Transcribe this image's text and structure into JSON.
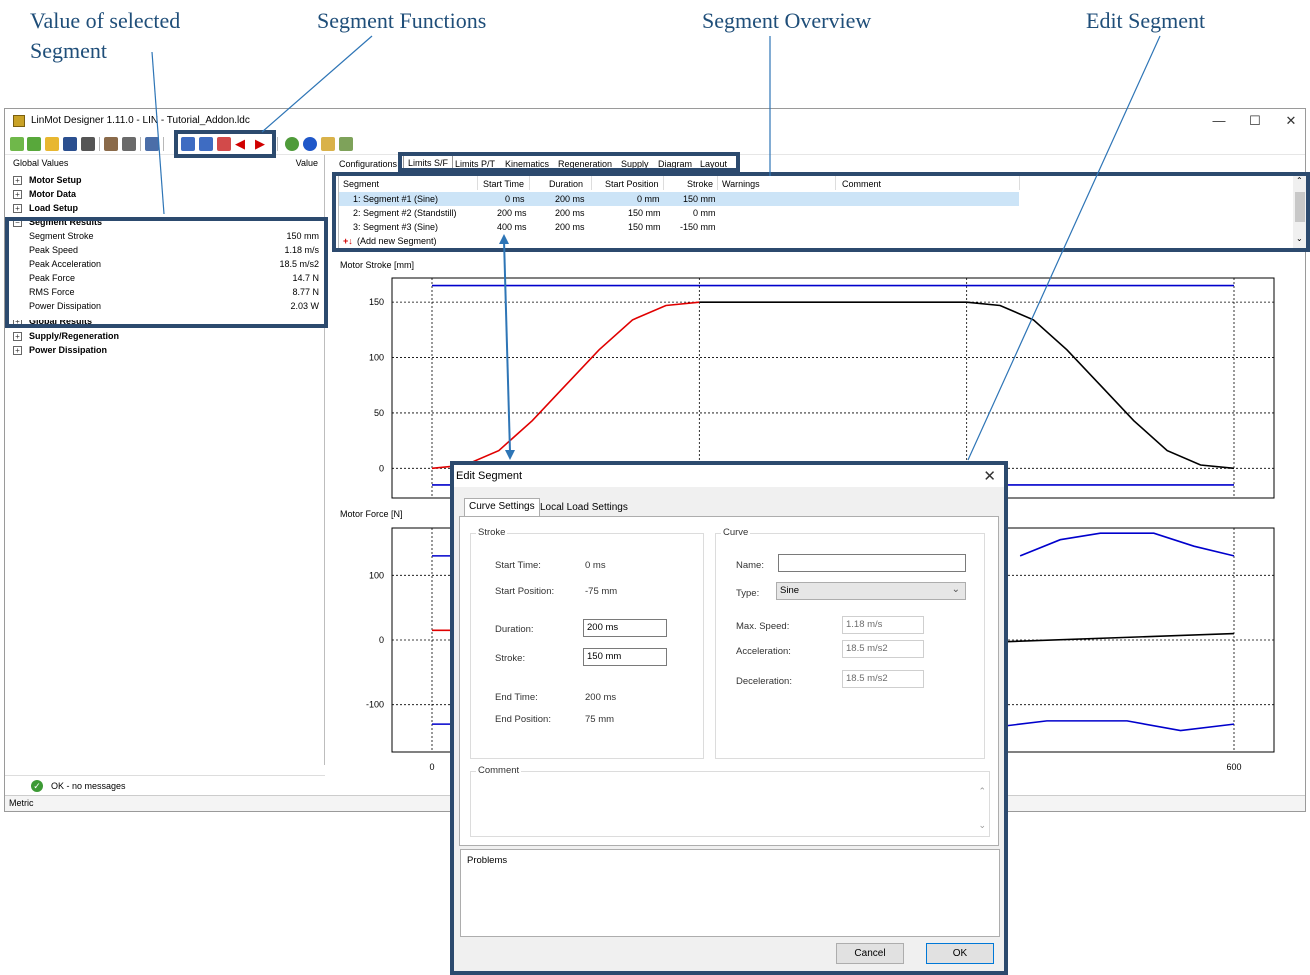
{
  "annotations": {
    "value_of_selected_segment": "Value of selected Segment",
    "value_line1": "Value of selected",
    "value_line2": "Segment",
    "segment_functions": "Segment Functions",
    "segment_overview": "Segment Overview",
    "edit_segment": "Edit Segment",
    "highlight_color": "#2c4a6e"
  },
  "window": {
    "title": "LinMot Designer 1.11.0 - LIN - Tutorial_Addon.ldc",
    "minimize": "—",
    "maximize": "☐",
    "close": "✕"
  },
  "left_panel": {
    "header_col1": "Global Values",
    "header_col2": "Value",
    "groups_top": [
      {
        "label": "Motor Setup",
        "state": "+"
      },
      {
        "label": "Motor Data",
        "state": "+"
      },
      {
        "label": "Load Setup",
        "state": "+"
      }
    ],
    "segment_results": {
      "label": "Segment Results",
      "state": "−",
      "rows": [
        {
          "label": "Segment Stroke",
          "value": "150 mm"
        },
        {
          "label": "Peak Speed",
          "value": "1.18 m/s"
        },
        {
          "label": "Peak Acceleration",
          "value": "18.5 m/s2"
        },
        {
          "label": "Peak Force",
          "value": "14.7 N"
        },
        {
          "label": "RMS Force",
          "value": "8.77 N"
        },
        {
          "label": "Power Dissipation",
          "value": "2.03 W"
        }
      ]
    },
    "groups_bottom": [
      {
        "label": "Global Results",
        "state": "+"
      },
      {
        "label": "Supply/Regeneration",
        "state": "+"
      },
      {
        "label": "Power Dissipation",
        "state": "+"
      }
    ],
    "status_message": "OK - no messages",
    "unit_system": "Metric"
  },
  "tabs": [
    "Configurations",
    "Limits S/F",
    "Limits P/T",
    "Kinematics",
    "Regeneration",
    "Supply",
    "Diagram",
    "Layout"
  ],
  "active_tab": "Limits S/F",
  "segment_table": {
    "columns": [
      "Segment",
      "Start Time",
      "Duration",
      "Start Position",
      "Stroke",
      "Warnings",
      "Comment"
    ],
    "rows": [
      {
        "segment": "1:  Segment #1 (Sine)",
        "start_time": "0 ms",
        "duration": "200 ms",
        "start_position": "0 mm",
        "stroke": "150 mm",
        "selected": true
      },
      {
        "segment": "2:  Segment #2 (Standstill)",
        "start_time": "200 ms",
        "duration": "200 ms",
        "start_position": "150 mm",
        "stroke": "0 mm",
        "selected": false
      },
      {
        "segment": "3:  Segment #3 (Sine)",
        "start_time": "400 ms",
        "duration": "200 ms",
        "start_position": "150 mm",
        "stroke": "-150 mm",
        "selected": false
      }
    ],
    "add_new": "(Add new Segment)"
  },
  "charts": {
    "stroke_title": "Motor Stroke [mm]",
    "stroke_ticks": [
      "150",
      "100",
      "50",
      "0"
    ],
    "force_title": "Motor Force [N]",
    "force_ticks": [
      "100",
      "0",
      "-100"
    ],
    "x_ticks": [
      "0",
      "600"
    ],
    "colors": {
      "selected": "#e00000",
      "other": "#000000",
      "limit": "#0000cc"
    }
  },
  "chart_data": [
    {
      "type": "line",
      "title": "Motor Stroke [mm]",
      "xlim": [
        0,
        600
      ],
      "ylim": [
        -25,
        170
      ],
      "series": [
        {
          "color": "#e00000",
          "x": [
            0,
            25,
            50,
            75,
            100,
            125,
            150,
            175,
            200
          ],
          "y": [
            0,
            3,
            16,
            43,
            75,
            107,
            134,
            147,
            150
          ]
        },
        {
          "color": "#000000",
          "x": [
            200,
            400,
            425,
            450,
            475,
            500,
            525,
            550,
            575,
            600
          ],
          "y": [
            150,
            150,
            147,
            134,
            107,
            75,
            43,
            16,
            3,
            0
          ]
        },
        {
          "color": "#0000cc",
          "x": [
            0,
            600
          ],
          "y": [
            165,
            165
          ]
        },
        {
          "color": "#0000cc",
          "x": [
            0,
            600
          ],
          "y": [
            -15,
            -15
          ]
        }
      ]
    },
    {
      "type": "line",
      "title": "Motor Force [N]",
      "xlim": [
        0,
        600
      ],
      "ylim": [
        -170,
        170
      ],
      "series": [
        {
          "color": "#e00000",
          "x": [
            0,
            20
          ],
          "y": [
            15,
            15
          ]
        },
        {
          "color": "#000000",
          "x": [
            330,
            600
          ],
          "y": [
            -10,
            10
          ]
        },
        {
          "color": "#0000cc",
          "x": [
            0,
            20
          ],
          "y": [
            130,
            130
          ]
        },
        {
          "color": "#0000cc",
          "x": [
            440,
            470,
            500,
            540,
            570,
            600
          ],
          "y": [
            130,
            155,
            165,
            165,
            145,
            130
          ]
        },
        {
          "color": "#0000cc",
          "x": [
            0,
            20
          ],
          "y": [
            -130,
            -130
          ]
        },
        {
          "color": "#0000cc",
          "x": [
            330,
            400,
            460,
            520,
            560,
            600
          ],
          "y": [
            -140,
            -140,
            -125,
            -125,
            -140,
            -130
          ]
        }
      ]
    }
  ],
  "dialog": {
    "title": "Edit Segment",
    "close": "✕",
    "tabs": [
      "Curve Settings",
      "Local Load Settings"
    ],
    "stroke_group": "Stroke",
    "curve_group": "Curve",
    "start_time_label": "Start Time:",
    "start_time_value": "0 ms",
    "start_position_label": "Start Position:",
    "start_position_value": "-75 mm",
    "duration_label": "Duration:",
    "duration_value": "200 ms",
    "stroke_label": "Stroke:",
    "stroke_value": "150 mm",
    "end_time_label": "End Time:",
    "end_time_value": "200 ms",
    "end_position_label": "End Position:",
    "end_position_value": "75 mm",
    "name_label": "Name:",
    "name_value": "",
    "type_label": "Type:",
    "type_value": "Sine",
    "max_speed_label": "Max. Speed:",
    "max_speed_value": "1.18 m/s",
    "acceleration_label": "Acceleration:",
    "acceleration_value": "18.5 m/s2",
    "deceleration_label": "Deceleration:",
    "deceleration_value": "18.5 m/s2",
    "comment_label": "Comment",
    "problems_label": "Problems",
    "cancel": "Cancel",
    "ok": "OK"
  },
  "toolbar_icons": [
    "new-file-icon",
    "refresh-icon",
    "open-folder-icon",
    "save-icon",
    "print-icon",
    "motor-icon",
    "motor-select-icon",
    "segment-list-icon",
    "add-segment-icon",
    "insert-segment-icon",
    "segment-chart-icon",
    "move-left-icon",
    "move-right-icon",
    "recalculate-icon",
    "info-icon",
    "export-icon",
    "help-icon"
  ]
}
